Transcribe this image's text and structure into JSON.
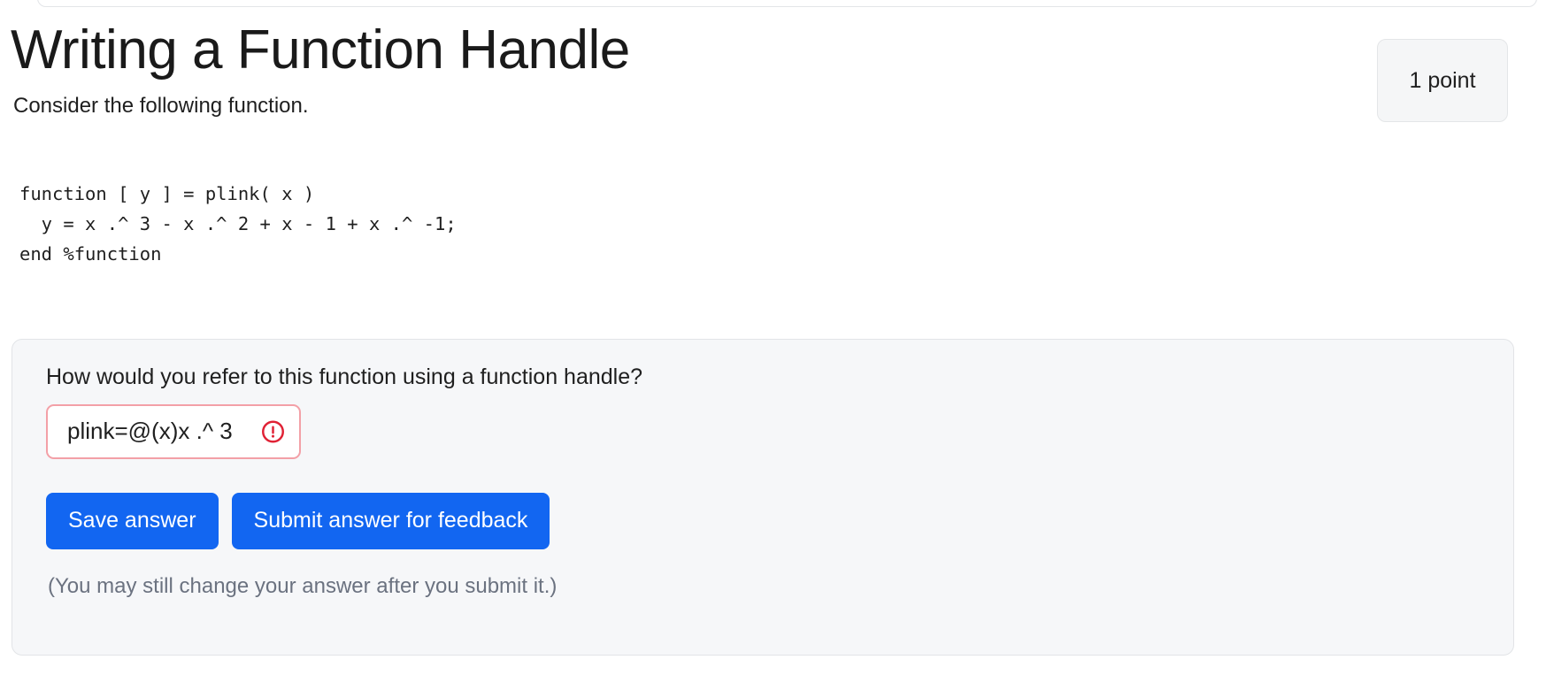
{
  "header": {
    "title": "Writing a Function Handle",
    "intro": "Consider the following function.",
    "points_badge": "1 point"
  },
  "code": {
    "language": "matlab",
    "lines": [
      "function [ y ] = plink( x )",
      "  y = x .^ 3 - x .^ 2 + x - 1 + x .^ -1;",
      "end %function"
    ],
    "text": "function [ y ] = plink( x )\n  y = x .^ 3 - x .^ 2 + x - 1 + x .^ -1;\nend %function"
  },
  "answer_card": {
    "question": "How would you refer to this function using a function handle?",
    "input": {
      "value": "plink=@(x)x .^ 3",
      "placeholder": "",
      "state": "error",
      "error_icon": "exclamation-circle-icon",
      "border_color": "#f3a0a7",
      "icon_color": "#e02235"
    },
    "save_label": "Save answer",
    "submit_label": "Submit answer for feedback",
    "hint": "(You may still change your answer after you submit it.)",
    "accent_color": "#1266f1"
  }
}
